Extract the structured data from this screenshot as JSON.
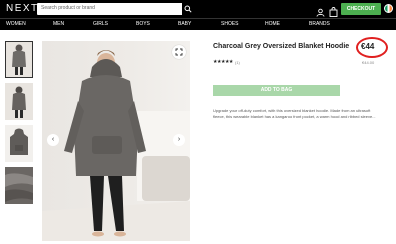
{
  "header": {
    "logo": "NEXT",
    "search_placeholder": "Search product or brand",
    "checkout_label": "CHECKOUT"
  },
  "nav": {
    "items": [
      {
        "label": "WOMEN"
      },
      {
        "label": "MEN"
      },
      {
        "label": "GIRLS"
      },
      {
        "label": "BOYS"
      },
      {
        "label": "BABY"
      },
      {
        "label": "SHOES"
      },
      {
        "label": "HOME"
      },
      {
        "label": "BRANDS"
      }
    ]
  },
  "product": {
    "title": "Charcoal Grey Oversized Blanket Hoodie",
    "price": "€44",
    "rating_stars": "★★★★★",
    "rating_value": 5,
    "review_count": "(1)",
    "old_price": "€44.00",
    "add_to_bag_label": "ADD TO BAG",
    "description": "Upgrade your off-duty comfort, with this oversized blanket hoodie. Made from an ultrasoft fleece, this wearable blanket has a kangaroo front pocket, a warm hood and ribbed sleeve..."
  },
  "gallery": {
    "prev_icon": "‹",
    "next_icon": "›"
  },
  "colors": {
    "accent_green": "#4caf50",
    "add_to_bag_disabled": "#a9d7a9",
    "price_highlight": "#e02020"
  }
}
